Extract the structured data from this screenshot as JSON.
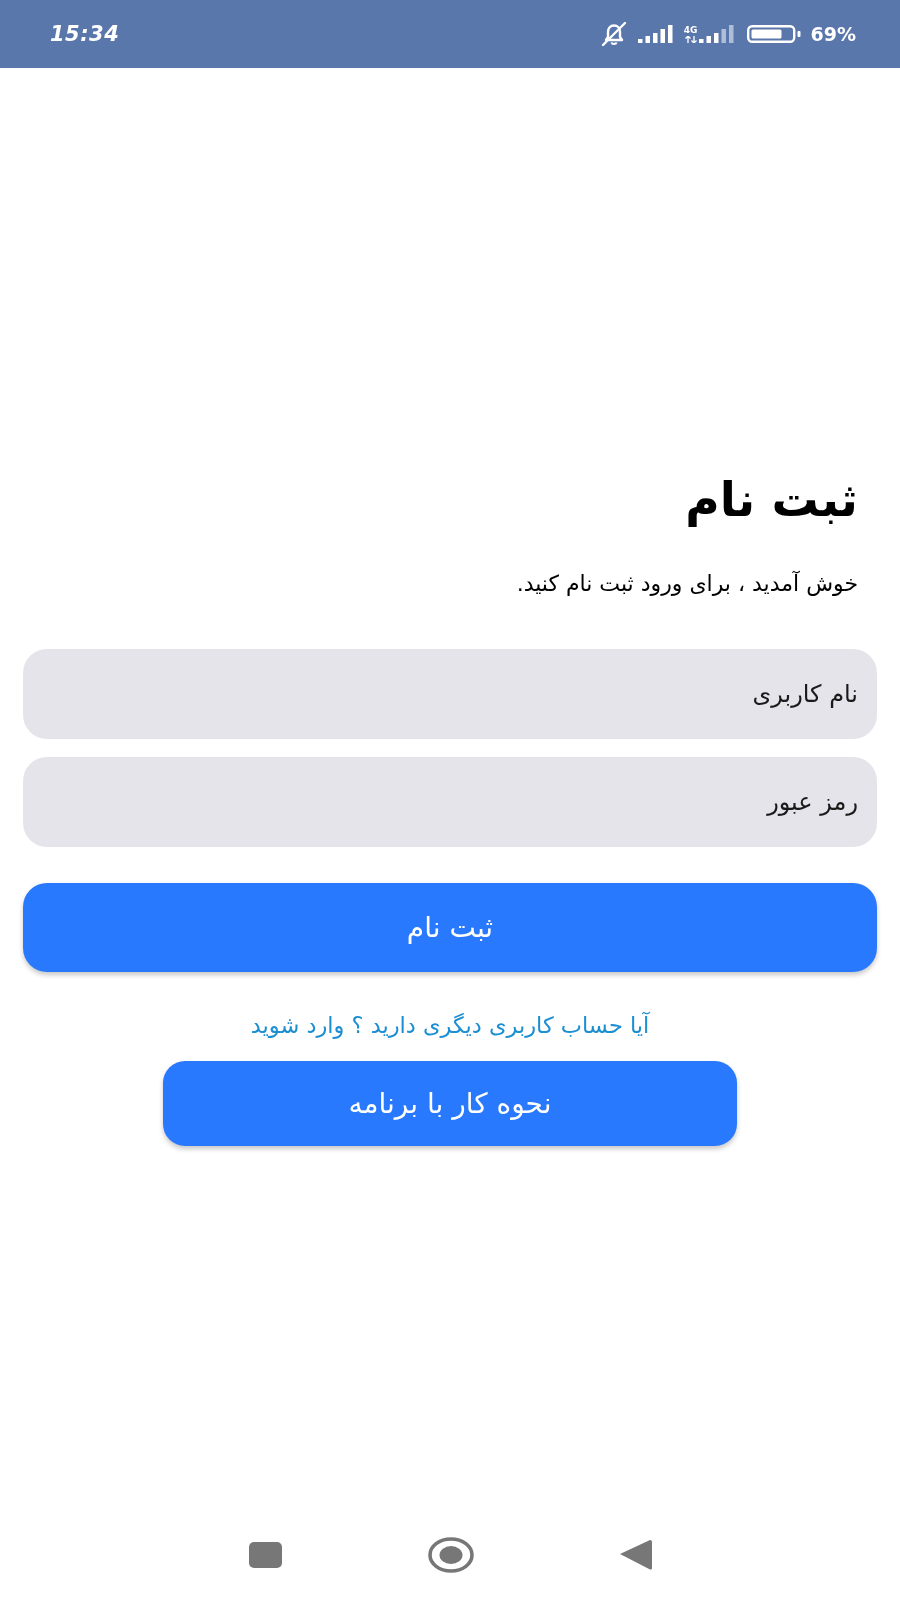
{
  "status_bar": {
    "time": "15:34",
    "network_type": "4G",
    "battery": "69%"
  },
  "title": "ثبت نام",
  "subtitle": "خوش آمدید ، برای ورود ثبت نام کنید.",
  "fields": [
    {
      "placeholder": "نام کاربری"
    },
    {
      "placeholder": "رمز عبور"
    }
  ],
  "submit_button": "ثبت نام",
  "login_link": "آیا حساب کاربری دیگری دارید ؟ وارد شوید",
  "help_button": "نحوه کار با برنامه"
}
